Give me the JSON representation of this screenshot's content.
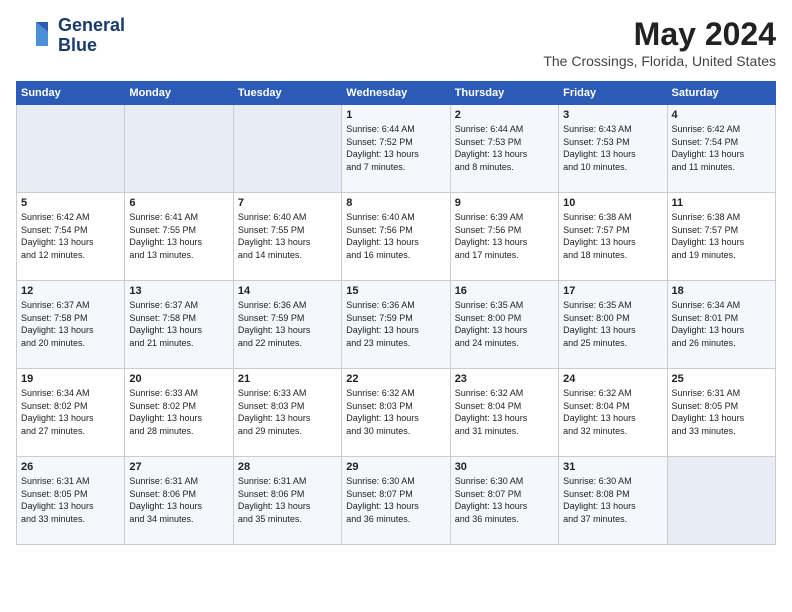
{
  "header": {
    "logo_line1": "General",
    "logo_line2": "Blue",
    "month": "May 2024",
    "location": "The Crossings, Florida, United States"
  },
  "weekdays": [
    "Sunday",
    "Monday",
    "Tuesday",
    "Wednesday",
    "Thursday",
    "Friday",
    "Saturday"
  ],
  "weeks": [
    [
      {
        "day": "",
        "info": ""
      },
      {
        "day": "",
        "info": ""
      },
      {
        "day": "",
        "info": ""
      },
      {
        "day": "1",
        "info": "Sunrise: 6:44 AM\nSunset: 7:52 PM\nDaylight: 13 hours\nand 7 minutes."
      },
      {
        "day": "2",
        "info": "Sunrise: 6:44 AM\nSunset: 7:53 PM\nDaylight: 13 hours\nand 8 minutes."
      },
      {
        "day": "3",
        "info": "Sunrise: 6:43 AM\nSunset: 7:53 PM\nDaylight: 13 hours\nand 10 minutes."
      },
      {
        "day": "4",
        "info": "Sunrise: 6:42 AM\nSunset: 7:54 PM\nDaylight: 13 hours\nand 11 minutes."
      }
    ],
    [
      {
        "day": "5",
        "info": "Sunrise: 6:42 AM\nSunset: 7:54 PM\nDaylight: 13 hours\nand 12 minutes."
      },
      {
        "day": "6",
        "info": "Sunrise: 6:41 AM\nSunset: 7:55 PM\nDaylight: 13 hours\nand 13 minutes."
      },
      {
        "day": "7",
        "info": "Sunrise: 6:40 AM\nSunset: 7:55 PM\nDaylight: 13 hours\nand 14 minutes."
      },
      {
        "day": "8",
        "info": "Sunrise: 6:40 AM\nSunset: 7:56 PM\nDaylight: 13 hours\nand 16 minutes."
      },
      {
        "day": "9",
        "info": "Sunrise: 6:39 AM\nSunset: 7:56 PM\nDaylight: 13 hours\nand 17 minutes."
      },
      {
        "day": "10",
        "info": "Sunrise: 6:38 AM\nSunset: 7:57 PM\nDaylight: 13 hours\nand 18 minutes."
      },
      {
        "day": "11",
        "info": "Sunrise: 6:38 AM\nSunset: 7:57 PM\nDaylight: 13 hours\nand 19 minutes."
      }
    ],
    [
      {
        "day": "12",
        "info": "Sunrise: 6:37 AM\nSunset: 7:58 PM\nDaylight: 13 hours\nand 20 minutes."
      },
      {
        "day": "13",
        "info": "Sunrise: 6:37 AM\nSunset: 7:58 PM\nDaylight: 13 hours\nand 21 minutes."
      },
      {
        "day": "14",
        "info": "Sunrise: 6:36 AM\nSunset: 7:59 PM\nDaylight: 13 hours\nand 22 minutes."
      },
      {
        "day": "15",
        "info": "Sunrise: 6:36 AM\nSunset: 7:59 PM\nDaylight: 13 hours\nand 23 minutes."
      },
      {
        "day": "16",
        "info": "Sunrise: 6:35 AM\nSunset: 8:00 PM\nDaylight: 13 hours\nand 24 minutes."
      },
      {
        "day": "17",
        "info": "Sunrise: 6:35 AM\nSunset: 8:00 PM\nDaylight: 13 hours\nand 25 minutes."
      },
      {
        "day": "18",
        "info": "Sunrise: 6:34 AM\nSunset: 8:01 PM\nDaylight: 13 hours\nand 26 minutes."
      }
    ],
    [
      {
        "day": "19",
        "info": "Sunrise: 6:34 AM\nSunset: 8:02 PM\nDaylight: 13 hours\nand 27 minutes."
      },
      {
        "day": "20",
        "info": "Sunrise: 6:33 AM\nSunset: 8:02 PM\nDaylight: 13 hours\nand 28 minutes."
      },
      {
        "day": "21",
        "info": "Sunrise: 6:33 AM\nSunset: 8:03 PM\nDaylight: 13 hours\nand 29 minutes."
      },
      {
        "day": "22",
        "info": "Sunrise: 6:32 AM\nSunset: 8:03 PM\nDaylight: 13 hours\nand 30 minutes."
      },
      {
        "day": "23",
        "info": "Sunrise: 6:32 AM\nSunset: 8:04 PM\nDaylight: 13 hours\nand 31 minutes."
      },
      {
        "day": "24",
        "info": "Sunrise: 6:32 AM\nSunset: 8:04 PM\nDaylight: 13 hours\nand 32 minutes."
      },
      {
        "day": "25",
        "info": "Sunrise: 6:31 AM\nSunset: 8:05 PM\nDaylight: 13 hours\nand 33 minutes."
      }
    ],
    [
      {
        "day": "26",
        "info": "Sunrise: 6:31 AM\nSunset: 8:05 PM\nDaylight: 13 hours\nand 33 minutes."
      },
      {
        "day": "27",
        "info": "Sunrise: 6:31 AM\nSunset: 8:06 PM\nDaylight: 13 hours\nand 34 minutes."
      },
      {
        "day": "28",
        "info": "Sunrise: 6:31 AM\nSunset: 8:06 PM\nDaylight: 13 hours\nand 35 minutes."
      },
      {
        "day": "29",
        "info": "Sunrise: 6:30 AM\nSunset: 8:07 PM\nDaylight: 13 hours\nand 36 minutes."
      },
      {
        "day": "30",
        "info": "Sunrise: 6:30 AM\nSunset: 8:07 PM\nDaylight: 13 hours\nand 36 minutes."
      },
      {
        "day": "31",
        "info": "Sunrise: 6:30 AM\nSunset: 8:08 PM\nDaylight: 13 hours\nand 37 minutes."
      },
      {
        "day": "",
        "info": ""
      }
    ]
  ]
}
